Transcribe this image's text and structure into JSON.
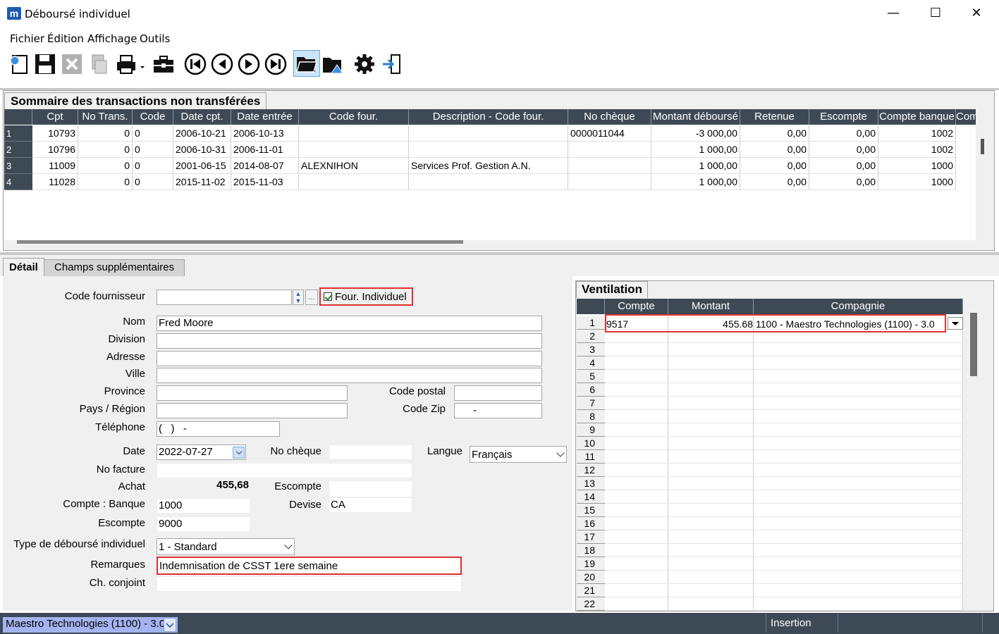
{
  "window": {
    "title": "Déboursé individuel",
    "app_icon": "m",
    "minimize": "—",
    "maximize": "☐",
    "close": "✕"
  },
  "menu": [
    "Fichier",
    "Édition",
    "Affichage",
    "Outils"
  ],
  "toolbar_icons": [
    "new-icon",
    "save-icon",
    "delete-icon",
    "transfer-icon",
    "print-icon",
    "briefcase-icon",
    "first-icon",
    "previous-icon",
    "next-icon",
    "last-icon",
    "open-folder-icon",
    "folder-search-icon",
    "settings-icon",
    "exit-icon"
  ],
  "summary": {
    "title": "Sommaire des transactions non transférées",
    "columns": [
      "Cpt",
      "No Trans.",
      "Code",
      "Date cpt.",
      "Date entrée",
      "Code four.",
      "Description - Code four.",
      "No chèque",
      "Montant déboursé",
      "Retenue",
      "Escompte",
      "Compte banque",
      "Compt"
    ],
    "rows": [
      {
        "n": "1",
        "cpt": "10793",
        "notrans": "0",
        "code": "0",
        "datecpt": "2006-10-21",
        "dateentree": "2006-10-13",
        "codefour": "",
        "desc": "",
        "nocheque": "0000011044",
        "montant": "-3 000,00",
        "retenue": "0,00",
        "escompte": "0,00",
        "banque": "1002"
      },
      {
        "n": "2",
        "cpt": "10796",
        "notrans": "0",
        "code": "0",
        "datecpt": "2006-10-31",
        "dateentree": "2006-11-01",
        "codefour": "",
        "desc": "",
        "nocheque": "",
        "montant": "1 000,00",
        "retenue": "0,00",
        "escompte": "0,00",
        "banque": "1002"
      },
      {
        "n": "3",
        "cpt": "11009",
        "notrans": "0",
        "code": "0",
        "datecpt": "2001-06-15",
        "dateentree": "2014-08-07",
        "codefour": "ALEXNIHON",
        "desc": "Services Prof. Gestion A.N.",
        "nocheque": "",
        "montant": "1 000,00",
        "retenue": "0,00",
        "escompte": "0,00",
        "banque": "1000"
      },
      {
        "n": "4",
        "cpt": "11028",
        "notrans": "0",
        "code": "0",
        "datecpt": "2015-11-02",
        "dateentree": "2015-11-03",
        "codefour": "",
        "desc": "",
        "nocheque": "",
        "montant": "1 000,00",
        "retenue": "0,00",
        "escompte": "0,00",
        "banque": "1000"
      }
    ]
  },
  "tabs": [
    "Détail",
    "Champs supplémentaires"
  ],
  "detail": {
    "code_fournisseur_label": "Code fournisseur",
    "code_fournisseur": "",
    "ellipsis": "...",
    "four_individuel_label": "Four. Individuel",
    "nom_label": "Nom",
    "nom": "Fred Moore",
    "division_label": "Division",
    "division": "",
    "adresse_label": "Adresse",
    "adresse": "",
    "ville_label": "Ville",
    "ville": "",
    "province_label": "Province",
    "province": "",
    "code_postal_label": "Code postal",
    "code_postal": "",
    "pays_label": "Pays / Région",
    "pays": "",
    "code_zip_label": "Code Zip",
    "code_zip": "-",
    "telephone_label": "Téléphone",
    "telephone": "(   )   -",
    "date_label": "Date",
    "date": "2022-07-27",
    "no_cheque_label": "No chèque",
    "no_cheque": "",
    "langue_label": "Langue",
    "langue": "Français",
    "no_facture_label": "No facture",
    "no_facture": "",
    "achat_label": "Achat",
    "achat": "455,68",
    "escompte_label": "Escompte",
    "escompte": "",
    "compte_banque_label": "Compte : Banque",
    "compte_banque": "1000",
    "devise_label": "Devise",
    "devise": "CA",
    "compte_escompte_label": "Escompte",
    "compte_escompte": "9000",
    "type_label": "Type de déboursé individuel",
    "type": "1 - Standard",
    "remarques_label": "Remarques",
    "remarques": "Indemnisation de CSST 1ere semaine",
    "conjoint_label": "Ch. conjoint",
    "conjoint": ""
  },
  "ventilation": {
    "title": "Ventilation",
    "columns": [
      "Compte",
      "Montant",
      "Compagnie"
    ],
    "row1": {
      "compte": "9517",
      "montant": "455.68",
      "compagnie": "1100 - Maestro Technologies (1100) - 3.0"
    },
    "row_numbers": [
      "1",
      "2",
      "3",
      "4",
      "5",
      "6",
      "7",
      "8",
      "9",
      "10",
      "11",
      "12",
      "13",
      "14",
      "15",
      "16",
      "17",
      "18",
      "19",
      "20",
      "21",
      "22"
    ]
  },
  "status": {
    "company": "Maestro Technologies (1100) - 3.0",
    "mode": "Insertion"
  },
  "colors": {
    "grid_header": "#3d4a56",
    "highlight": "#e03030",
    "company_select": "#a5b4f0"
  }
}
